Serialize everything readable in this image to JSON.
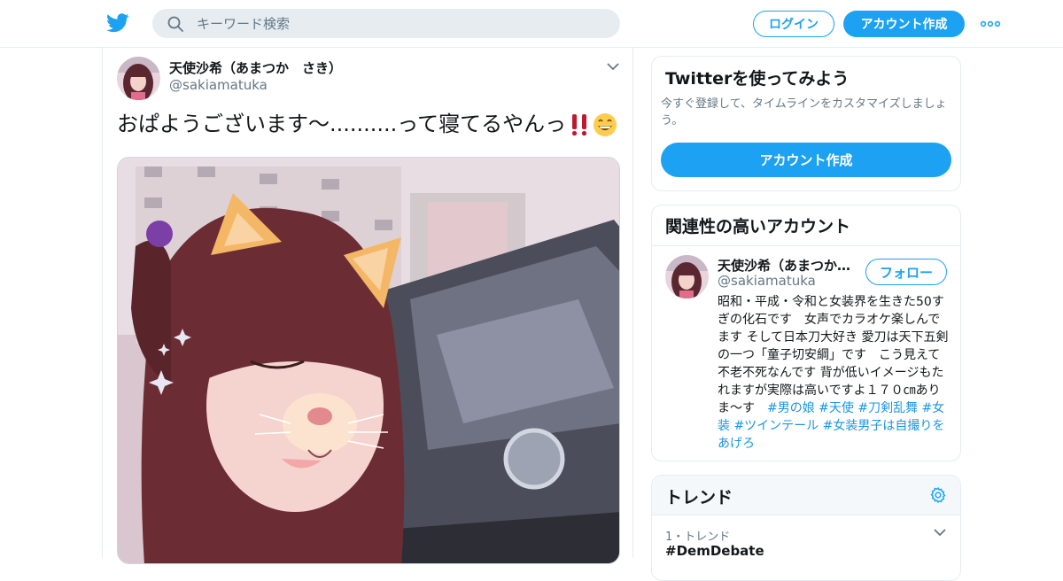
{
  "topbar": {
    "search_placeholder": "キーワード検索",
    "login_label": "ログイン",
    "signup_label": "アカウント作成",
    "brand_color": "#1da1f2"
  },
  "tweet": {
    "display_name": "天使沙希（あまつか　さき）",
    "handle": "@sakiamatuka",
    "text": "おぱようございます～..........って寝てるやんっ",
    "emojis": [
      "double-exclamation-icon",
      "grinning-face-icon"
    ]
  },
  "sidebar": {
    "try_card": {
      "title": "Twitterを使ってみよう",
      "description": "今すぐ登録して、タイムラインをカスタマイズしましょう。",
      "cta_label": "アカウント作成"
    },
    "related_card": {
      "title": "関連性の高いアカウント",
      "account": {
        "display_name": "天使沙希（あまつか…",
        "handle": "@sakiamatuka",
        "follow_label": "フォロー",
        "bio_text": "昭和・平成・令和と女装界を生きた50すぎの化石です　女声でカラオケ楽しんでます そして日本刀大好き 愛刀は天下五剣の一つ「童子切安綱」です　こう見えて不老不死なんです 背が低いイメージもたれますが実際は高いですよ１７０㎝ありま～す　",
        "bio_tags": "#男の娘 #天使 #刀剣乱舞 #女装 #ツインテール #女装男子は自撮りをあげろ"
      }
    },
    "trends_card": {
      "title": "トレンド",
      "items": [
        {
          "meta": "1・トレンド",
          "name": "#DemDebate"
        }
      ]
    }
  }
}
